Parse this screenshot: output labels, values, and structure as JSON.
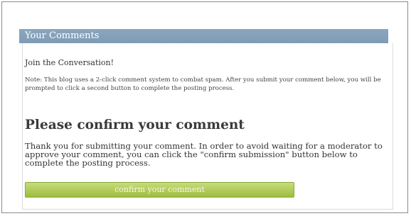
{
  "comments": {
    "header": "Your Comments",
    "intro": "Join the Conversation!",
    "note": "Note: This blog uses a 2-click comment system to combat spam. After you submit your comment below, you will be prompted to click a second button to complete the posting process.",
    "confirm_title": "Please confirm your comment",
    "thank_you": "Thank you for submitting your comment. In order to avoid waiting for a moderator to approve your comment, you can click the \"confirm submission\" button below to complete the posting process.",
    "confirm_button_label": "confirm your comment"
  }
}
